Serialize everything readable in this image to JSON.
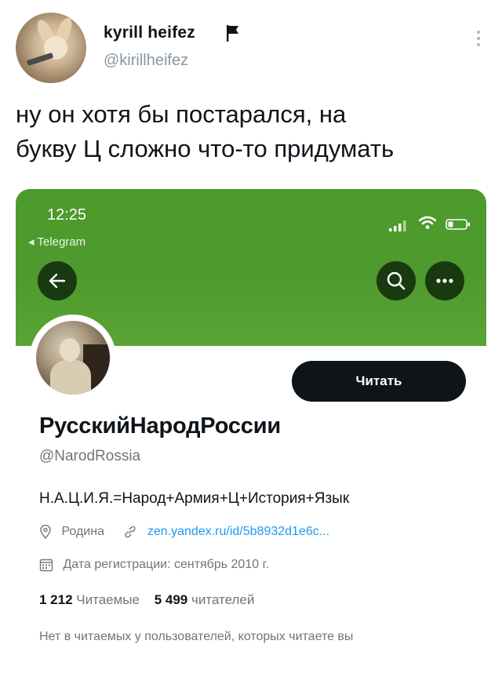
{
  "tweet": {
    "author_name": "kyrill heifez",
    "author_handle": "@kirillheifez",
    "text_line1": "ну он хотя бы постарался, на",
    "text_line2": "букву Ц сложно что-то придумать",
    "icons": {
      "flag": "flag-icon",
      "more": "more-vertical-icon"
    }
  },
  "screenshot": {
    "status_bar": {
      "time": "12:25",
      "back_app": "◂ Telegram",
      "icons": [
        "signal-icon",
        "wifi-icon",
        "battery-icon"
      ]
    },
    "banner_color": "#4f9a2e",
    "nav_buttons": [
      "back-arrow-icon",
      "search-icon",
      "more-horizontal-icon"
    ],
    "profile": {
      "follow_label": "Читать",
      "display_name": "РусскийНародРоссии",
      "username": "@NarodRossia",
      "bio": "Н.А.Ц.И.Я.=Народ+Армия+Ц+История+Язык",
      "location": "Родина",
      "link": "zen.yandex.ru/id/5b8932d1e6c...",
      "joined": "Дата регистрации: сентябрь 2010 г.",
      "following_count": "1 212",
      "following_label": "Читаемые",
      "followers_count": "5 499",
      "followers_label": "читателей",
      "mutuals_note": "Нет в читаемых у пользователей, которых читаете вы"
    }
  },
  "colors": {
    "accent_link": "#1d9bf0",
    "button_dark": "#0f1419",
    "muted": "#6e767d"
  }
}
